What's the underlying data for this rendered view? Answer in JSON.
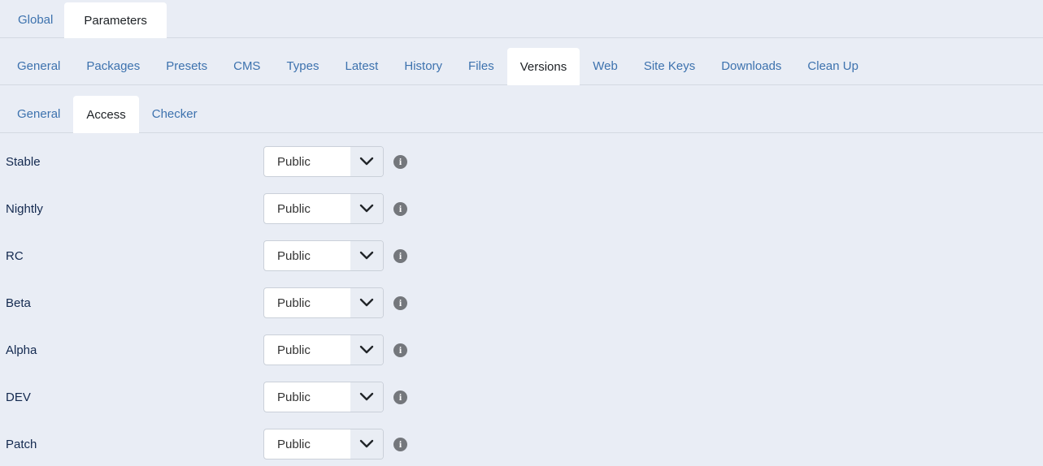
{
  "colors": {
    "background": "#e9edf5",
    "link_blue": "#3d72ae",
    "active_tab_text": "#1d2125",
    "label_navy": "#13294f",
    "bar_border": "#d4d9e2",
    "select_border": "#cad0d9",
    "select_arrow_zone": "#e9edf4",
    "info_icon_gray": "#74777c",
    "active_tab_bg": "#ffffff"
  },
  "tabs_level1": {
    "items": [
      {
        "label": "Global",
        "active": false
      },
      {
        "label": "Parameters",
        "active": true
      }
    ]
  },
  "tabs_level2": {
    "items": [
      {
        "label": "General",
        "active": false
      },
      {
        "label": "Packages",
        "active": false
      },
      {
        "label": "Presets",
        "active": false
      },
      {
        "label": "CMS",
        "active": false
      },
      {
        "label": "Types",
        "active": false
      },
      {
        "label": "Latest",
        "active": false
      },
      {
        "label": "History",
        "active": false
      },
      {
        "label": "Files",
        "active": false
      },
      {
        "label": "Versions",
        "active": true
      },
      {
        "label": "Web",
        "active": false
      },
      {
        "label": "Site Keys",
        "active": false
      },
      {
        "label": "Downloads",
        "active": false
      },
      {
        "label": "Clean Up",
        "active": false
      }
    ]
  },
  "tabs_level3": {
    "items": [
      {
        "label": "General",
        "active": false
      },
      {
        "label": "Access",
        "active": true
      },
      {
        "label": "Checker",
        "active": false
      }
    ]
  },
  "form": {
    "rows": [
      {
        "label": "Stable",
        "value": "Public"
      },
      {
        "label": "Nightly",
        "value": "Public"
      },
      {
        "label": "RC",
        "value": "Public"
      },
      {
        "label": "Beta",
        "value": "Public"
      },
      {
        "label": "Alpha",
        "value": "Public"
      },
      {
        "label": "DEV",
        "value": "Public"
      },
      {
        "label": "Patch",
        "value": "Public"
      }
    ]
  },
  "icons": {
    "info_glyph": "i",
    "chevron": "chevron-down"
  }
}
